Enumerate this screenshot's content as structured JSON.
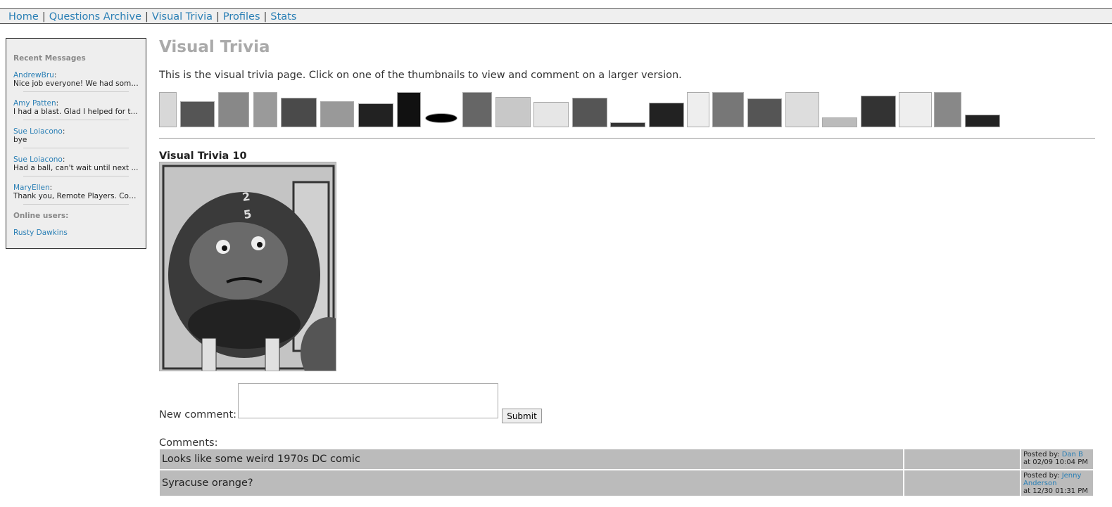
{
  "nav": {
    "items": [
      "Home",
      "Questions Archive",
      "Visual Trivia",
      "Profiles",
      "Stats"
    ],
    "separator": "|"
  },
  "sidebar": {
    "recent_title": "Recent Messages",
    "messages": [
      {
        "author": "AndrewBru",
        "text": "Nice job everyone! We had some..."
      },
      {
        "author": "Amy Patten",
        "text": "I had a blast. Glad I helped for t..."
      },
      {
        "author": "Sue Loiacono",
        "text": "bye"
      },
      {
        "author": "Sue Loiacono",
        "text": "Had a ball, can't wait until next ..."
      },
      {
        "author": "MaryEllen",
        "text": "Thank you, Remote Players. Coul..."
      }
    ],
    "online_title": "Online users:",
    "online_users": [
      "Rusty Dawkins"
    ]
  },
  "main": {
    "title": "Visual Trivia",
    "intro": "This is the visual trivia page. Click on one of the thumbnails to view and comment on a larger version.",
    "current_title": "Visual Trivia 10",
    "thumbnail_count": 23
  },
  "comment_form": {
    "label": "New comment:",
    "value": "",
    "submit_label": "Submit"
  },
  "comments": {
    "label": "Comments:",
    "items": [
      {
        "text": "Looks like some weird 1970s DC comic",
        "posted_by_label": "Posted by:",
        "author": "Dan B",
        "at": "at 02/09 10:04 PM"
      },
      {
        "text": "Syracuse orange?",
        "posted_by_label": "Posted by:",
        "author": "Jenny Anderson",
        "at": "at 12/30 01:31 PM"
      }
    ]
  },
  "colors": {
    "link": "#2a7fb5",
    "nav_bg": "#efefef",
    "sidebar_bg": "#eeeeee",
    "comment_bg": "#bbbbbb",
    "title_gray": "#aaaaaa"
  }
}
